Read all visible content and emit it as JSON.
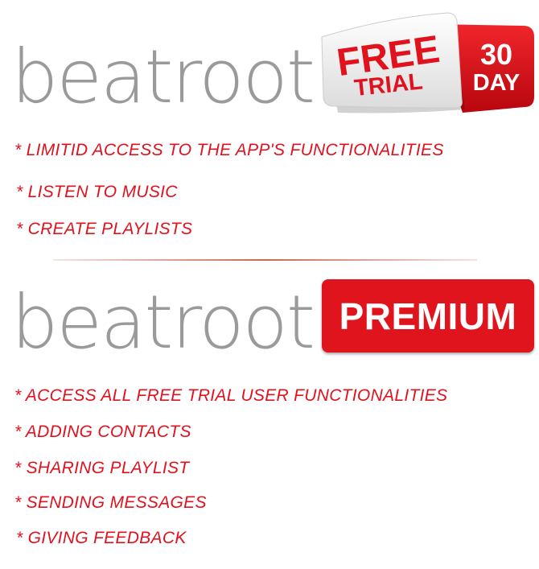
{
  "brand": {
    "logo_text": "beatroot"
  },
  "free_plan": {
    "badge_free": "FREE",
    "badge_trial": "TRIAL",
    "badge_days": "30",
    "badge_day_label": "DAY",
    "features": [
      "* LIMITID ACCESS TO THE APP'S FUNCTIONALITIES",
      "* LISTEN TO MUSIC",
      "* CREATE PLAYLISTS"
    ]
  },
  "premium_plan": {
    "badge_label": "PREMIUM",
    "features": [
      "* ACCESS ALL FREE TRIAL USER FUNCTIONALITIES",
      "* ADDING CONTACTS",
      "* SHARING PLAYLIST",
      "* SENDING MESSAGES",
      "* GIVING FEEDBACK"
    ]
  },
  "colors": {
    "accent_red": "#e0121e",
    "logo_gray": "#9a9a9a"
  }
}
